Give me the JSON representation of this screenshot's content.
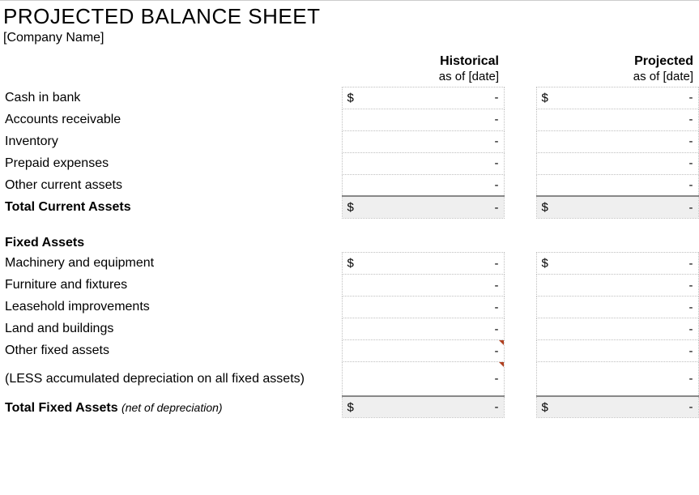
{
  "title": "PROJECTED BALANCE SHEET",
  "company": "[Company Name]",
  "columns": {
    "historical": {
      "main": "Historical",
      "sub": "as of [date]"
    },
    "projected": {
      "main": "Projected",
      "sub": "as of [date]"
    }
  },
  "current_assets": {
    "rows": [
      {
        "label": "Cash in bank",
        "hist_curr": "$",
        "hist_val": "-",
        "proj_curr": "$",
        "proj_val": "-"
      },
      {
        "label": "Accounts receivable",
        "hist_curr": "",
        "hist_val": "-",
        "proj_curr": "",
        "proj_val": "-"
      },
      {
        "label": "Inventory",
        "hist_curr": "",
        "hist_val": "-",
        "proj_curr": "",
        "proj_val": "-"
      },
      {
        "label": "Prepaid expenses",
        "hist_curr": "",
        "hist_val": "-",
        "proj_curr": "",
        "proj_val": "-"
      },
      {
        "label": "Other current assets",
        "hist_curr": "",
        "hist_val": "-",
        "proj_curr": "",
        "proj_val": "-"
      }
    ],
    "total": {
      "label": "Total Current Assets",
      "hist_curr": "$",
      "hist_val": "-",
      "proj_curr": "$",
      "proj_val": "-"
    }
  },
  "fixed_assets": {
    "heading": "Fixed Assets",
    "rows": [
      {
        "label": "Machinery and equipment",
        "hist_curr": "$",
        "hist_val": "-",
        "proj_curr": "$",
        "proj_val": "-"
      },
      {
        "label": "Furniture and fixtures",
        "hist_curr": "",
        "hist_val": "-",
        "proj_curr": "",
        "proj_val": "-"
      },
      {
        "label": "Leasehold improvements",
        "hist_curr": "",
        "hist_val": "-",
        "proj_curr": "",
        "proj_val": "-"
      },
      {
        "label": "Land and buildings",
        "hist_curr": "",
        "hist_val": "-",
        "proj_curr": "",
        "proj_val": "-"
      },
      {
        "label": "Other fixed assets",
        "hist_curr": "",
        "hist_val": "-",
        "proj_curr": "",
        "proj_val": "-"
      }
    ],
    "less": {
      "label": "(LESS accumulated depreciation on all fixed assets)",
      "hist_curr": "",
      "hist_val": "-",
      "proj_curr": "",
      "proj_val": "-"
    },
    "total": {
      "label_main": "Total Fixed Assets ",
      "label_sub": "(net of depreciation)",
      "hist_curr": "$",
      "hist_val": "-",
      "proj_curr": "$",
      "proj_val": "-"
    }
  }
}
